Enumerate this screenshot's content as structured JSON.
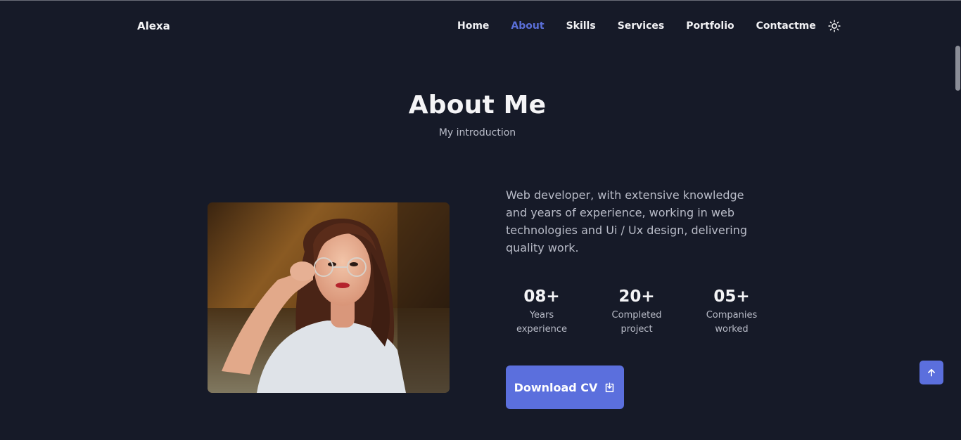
{
  "brand": {
    "logo": "Alexa"
  },
  "nav": {
    "items": [
      {
        "label": "Home"
      },
      {
        "label": "About"
      },
      {
        "label": "Skills"
      },
      {
        "label": "Services"
      },
      {
        "label": "Portfolio"
      },
      {
        "label": "Contactme"
      }
    ],
    "active": "About",
    "theme_icon": "sun-icon"
  },
  "about": {
    "title": "About Me",
    "subtitle": "My introduction",
    "description": "Web developer, with extensive knowledge and years of experience, working in web technologies and Ui / Ux design, delivering quality work.",
    "stats": [
      {
        "value": "08+",
        "label_line1": "Years",
        "label_line2": "experience"
      },
      {
        "value": "20+",
        "label_line1": "Completed",
        "label_line2": "project"
      },
      {
        "value": "05+",
        "label_line1": "Companies",
        "label_line2": "worked"
      }
    ],
    "download_label": "Download CV",
    "download_icon": "download-icon"
  },
  "scroll_up_icon": "arrow-up-icon",
  "colors": {
    "background": "#161a28",
    "accent": "#5b6fdd",
    "text_primary": "#f4f4f6",
    "text_secondary": "#b9bcc8"
  }
}
